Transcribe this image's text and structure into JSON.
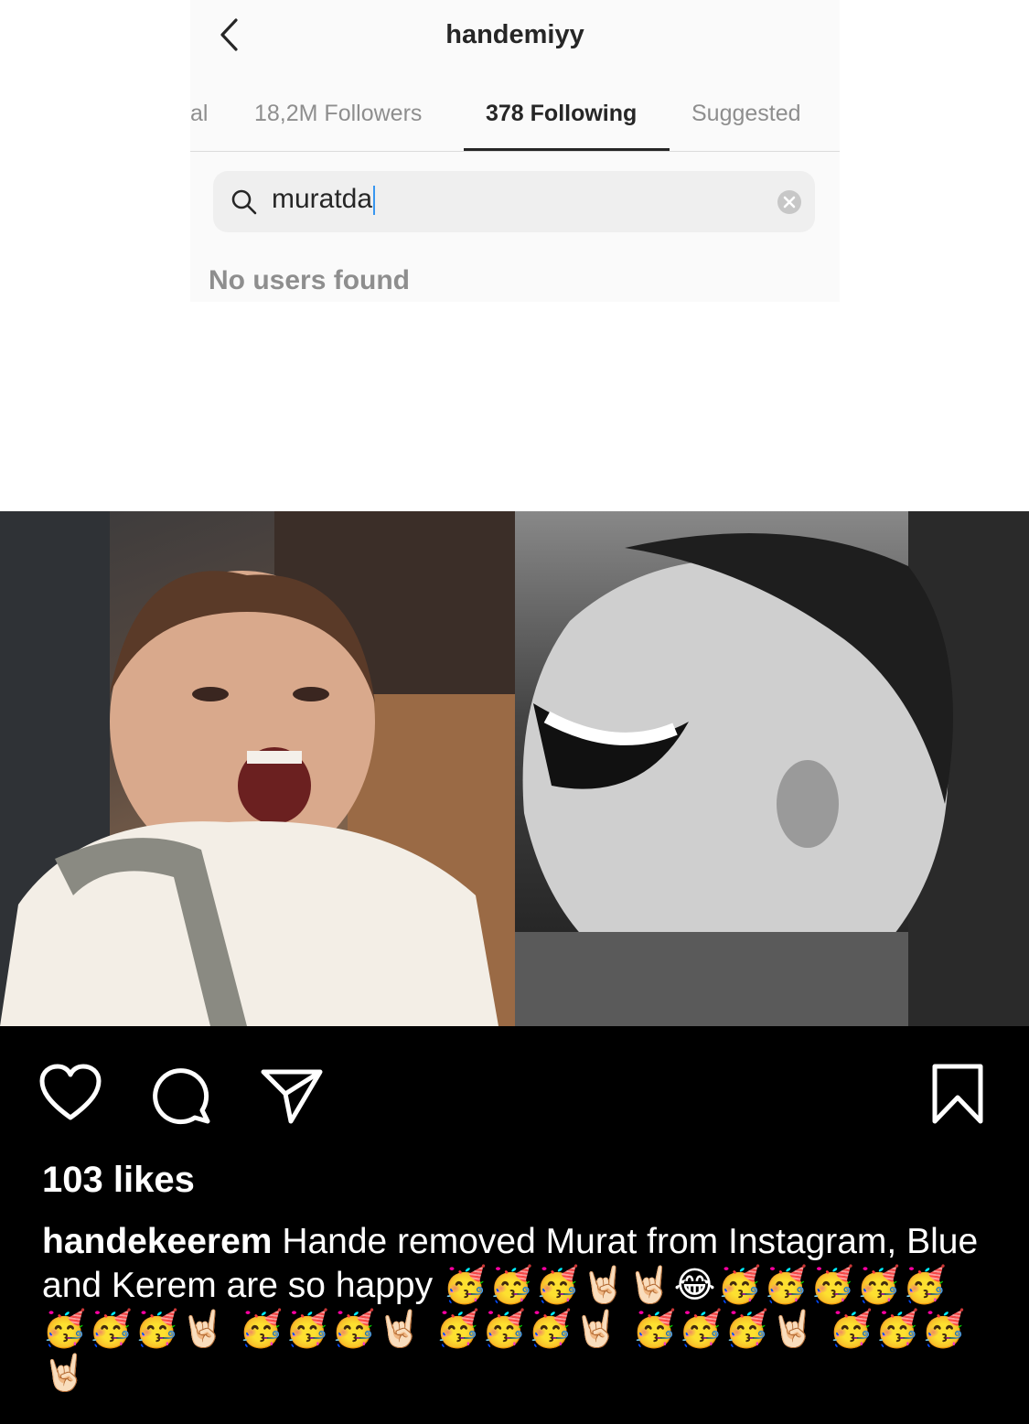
{
  "header": {
    "profile_name": "handemiyy",
    "back_icon": "chevron-left-icon"
  },
  "tabs": [
    {
      "label": "al",
      "active": false
    },
    {
      "label": "18,2M Followers",
      "active": false
    },
    {
      "label": "378 Following",
      "active": true
    },
    {
      "label": "Suggested",
      "active": false
    }
  ],
  "search": {
    "value": "muratda",
    "icon": "search-icon",
    "clear_icon": "clear-icon"
  },
  "results": {
    "empty_message": "No users found"
  },
  "post": {
    "likes": "103 likes",
    "username": "handekeerem",
    "caption_text": "Hande removed Murat from Instagram, Blue and Kerem are so happy",
    "caption_emojis": "🥳🥳🥳🤘🏻🤘🏻😂🥳🥳🥳🥳🥳 🥳🥳🥳🤘🏻 🥳🥳🥳🤘🏻 🥳🥳🥳🤘🏻 🥳🥳🥳🤘🏻 🥳🥳🥳🤘🏻",
    "icons": [
      "heart-icon",
      "comment-icon",
      "share-icon",
      "bookmark-icon"
    ]
  },
  "colors": {
    "active_tab": "#262626",
    "muted_text": "#8e8e8e",
    "post_background": "#000000"
  }
}
